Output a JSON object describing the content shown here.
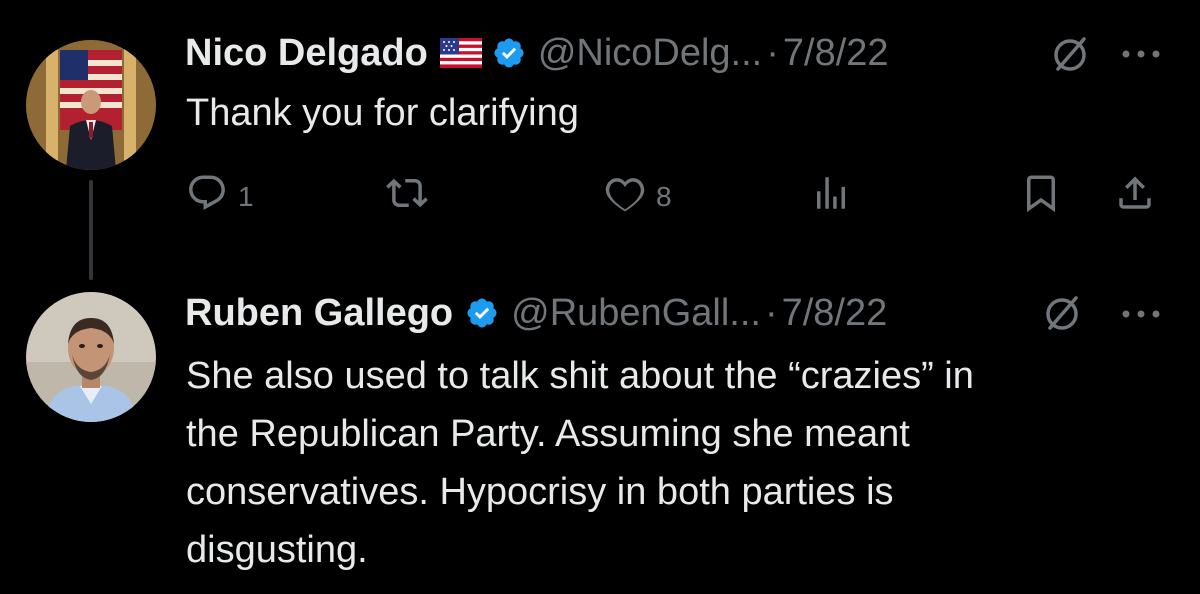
{
  "tweets": [
    {
      "display_name": "Nico Delgado",
      "flag_emoji": "us-flag",
      "verified": true,
      "handle": "@NicoDelg...",
      "separator": "·",
      "date": "7/8/22",
      "text_lines": [
        "Thank you for clarifying"
      ],
      "actions": {
        "reply_count": "1",
        "retweet_count": "",
        "like_count": "8"
      }
    },
    {
      "display_name": "Ruben Gallego",
      "verified": true,
      "handle": "@RubenGall...",
      "separator": "·",
      "date": "7/8/22",
      "text_lines": [
        "She also used to talk shit about the “crazies” in",
        "the Republican Party. Assuming she meant",
        "conservatives.  Hypocrisy in both parties is",
        "disgusting."
      ]
    }
  ],
  "icons": {
    "verified": "verified-badge-icon",
    "grok": "grok-icon",
    "more": "more-icon",
    "reply": "reply-icon",
    "retweet": "retweet-icon",
    "like": "heart-icon",
    "views": "views-icon",
    "bookmark": "bookmark-icon",
    "share": "share-icon"
  },
  "colors": {
    "background": "#000000",
    "text": "#e7e9ea",
    "muted": "#71767b",
    "verified": "#1d9bf0",
    "thread_line": "#333639"
  }
}
